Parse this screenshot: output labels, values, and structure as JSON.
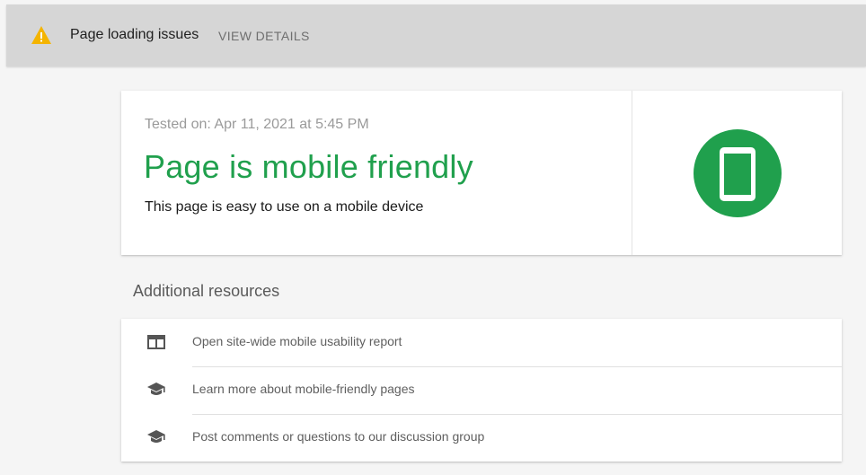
{
  "banner": {
    "title": "Page loading issues",
    "link_label": "VIEW DETAILS",
    "icon": "warning-icon",
    "icon_color": "#f4b400"
  },
  "result": {
    "tested_on": "Tested on: Apr 11, 2021 at 5:45 PM",
    "headline": "Page is mobile friendly",
    "description": "This page is easy to use on a mobile device",
    "status_color": "#20a04d",
    "icon": "mobile-phone-icon"
  },
  "resources": {
    "title": "Additional resources",
    "items": [
      {
        "label": "Open site-wide mobile usability report",
        "icon": "report-icon"
      },
      {
        "label": "Learn more about mobile-friendly pages",
        "icon": "school-icon"
      },
      {
        "label": "Post comments or questions to our discussion group",
        "icon": "school-icon"
      }
    ]
  }
}
